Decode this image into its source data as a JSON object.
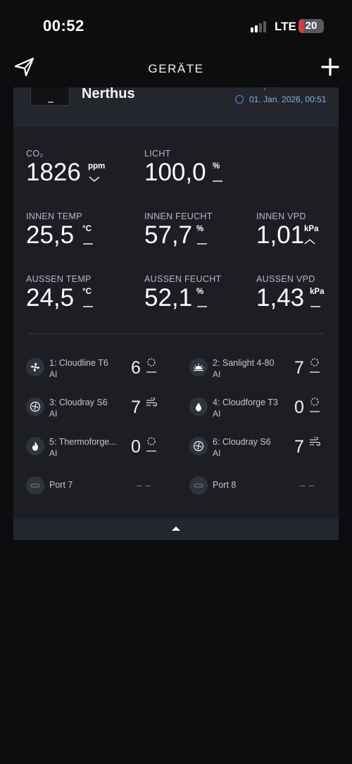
{
  "status_bar": {
    "time": "00:52",
    "network": "LTE",
    "battery": "20",
    "battery_fraction": 0.2,
    "signal_bars_active": 2,
    "signal_bars_total": 4
  },
  "nav": {
    "title": "GERÄTE",
    "logo_icon": "paper-plane-logo-icon",
    "add_icon": "plus-icon"
  },
  "device": {
    "name": "Nerthus",
    "last_update": "01. Jan. 2026, 00:51"
  },
  "metrics": {
    "co2": {
      "label": "CO₂",
      "value": "1826",
      "unit": "ppm",
      "trend": "down"
    },
    "light": {
      "label": "LICHT",
      "value": "100,0",
      "unit": "%",
      "trend": "flat"
    },
    "inner_temp": {
      "label": "INNEN TEMP",
      "value": "25,5",
      "unit": "°C",
      "trend": "flat"
    },
    "inner_humidity": {
      "label": "INNEN FEUCHT",
      "value": "57,7",
      "unit": "%",
      "trend": "flat"
    },
    "inner_vpd": {
      "label": "INNEN VPD",
      "value": "1,01",
      "unit": "kPa",
      "trend": "up"
    },
    "outer_temp": {
      "label": "AUSSEN TEMP",
      "value": "24,5",
      "unit": "°C",
      "trend": "flat"
    },
    "outer_humidity": {
      "label": "AUSSEN FEUCHT",
      "value": "52,1",
      "unit": "%",
      "trend": "flat"
    },
    "outer_vpd": {
      "label": "AUSSEN VPD",
      "value": "1,43",
      "unit": "kPa",
      "trend": "flat"
    }
  },
  "ports": [
    {
      "name": "1: Cloudline T6",
      "mode": "AI",
      "level": "6",
      "icon": "fan-icon",
      "state": "idle"
    },
    {
      "name": "2: Sanlight 4-80",
      "mode": "AI",
      "level": "7",
      "icon": "sunrise-icon",
      "state": "idle"
    },
    {
      "name": "3: Cloudray S6",
      "mode": "AI",
      "level": "7",
      "icon": "fan-icon",
      "state": "wind"
    },
    {
      "name": "4: Cloudforge T3",
      "mode": "AI",
      "level": "0",
      "icon": "water-drop-icon",
      "state": "idle"
    },
    {
      "name": "5: Thermoforge...",
      "mode": "AI",
      "level": "0",
      "icon": "flame-icon",
      "state": "idle"
    },
    {
      "name": "6: Cloudray S6",
      "mode": "AI",
      "level": "7",
      "icon": "fan-icon",
      "state": "wind"
    },
    {
      "name": "Port 7",
      "empty_text": "– –",
      "icon": "plug-icon"
    },
    {
      "name": "Port 8",
      "empty_text": "– –",
      "icon": "plug-icon"
    }
  ],
  "colors": {
    "background": "#0d0d0f",
    "card": "#1d1e23",
    "card_header": "#23262d",
    "accent_blue": "#5b8cde",
    "battery_red": "#e0393e"
  }
}
